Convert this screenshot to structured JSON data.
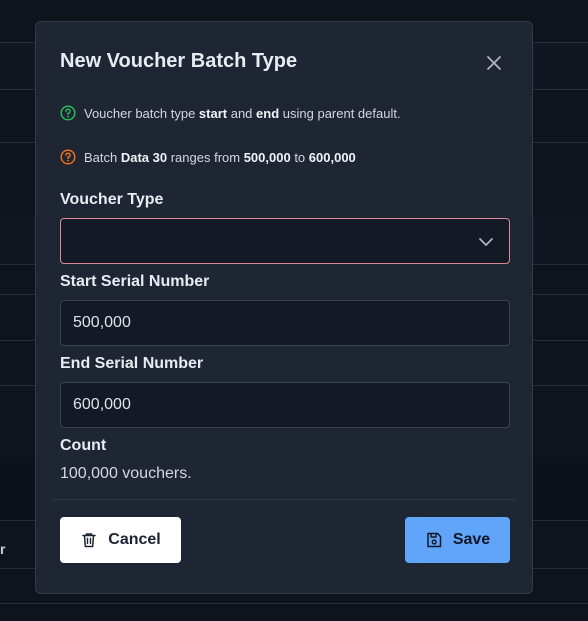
{
  "modal": {
    "title": "New Voucher Batch Type",
    "info1": {
      "pre": "Voucher batch type ",
      "b1": "start",
      "mid": " and ",
      "b2": "end",
      "post": " using parent default."
    },
    "info2": {
      "pre": "Batch ",
      "b1": "Data 30",
      "mid": " ranges from ",
      "b2": "500,000",
      "mid2": " to ",
      "b3": "600,000"
    },
    "voucher_type": {
      "label": "Voucher Type",
      "value": ""
    },
    "start_serial": {
      "label": "Start Serial Number",
      "value": "500,000"
    },
    "end_serial": {
      "label": "End Serial Number",
      "value": "600,000"
    },
    "count": {
      "label": "Count",
      "value": "100,000 vouchers."
    },
    "cancel_label": "Cancel",
    "save_label": "Save"
  },
  "background": {
    "partial_text": "r"
  },
  "colors": {
    "accent": "#60a5fa",
    "success_icon": "#22c55e",
    "warning_icon": "#f97316",
    "invalid_border": "#d98a94"
  },
  "icons": {
    "close": "close-icon",
    "info_success": "check-circle-question-icon",
    "info_warning": "question-circle-icon",
    "select_chevron": "chevron-down-icon",
    "cancel": "trash-icon",
    "save": "save-icon"
  }
}
